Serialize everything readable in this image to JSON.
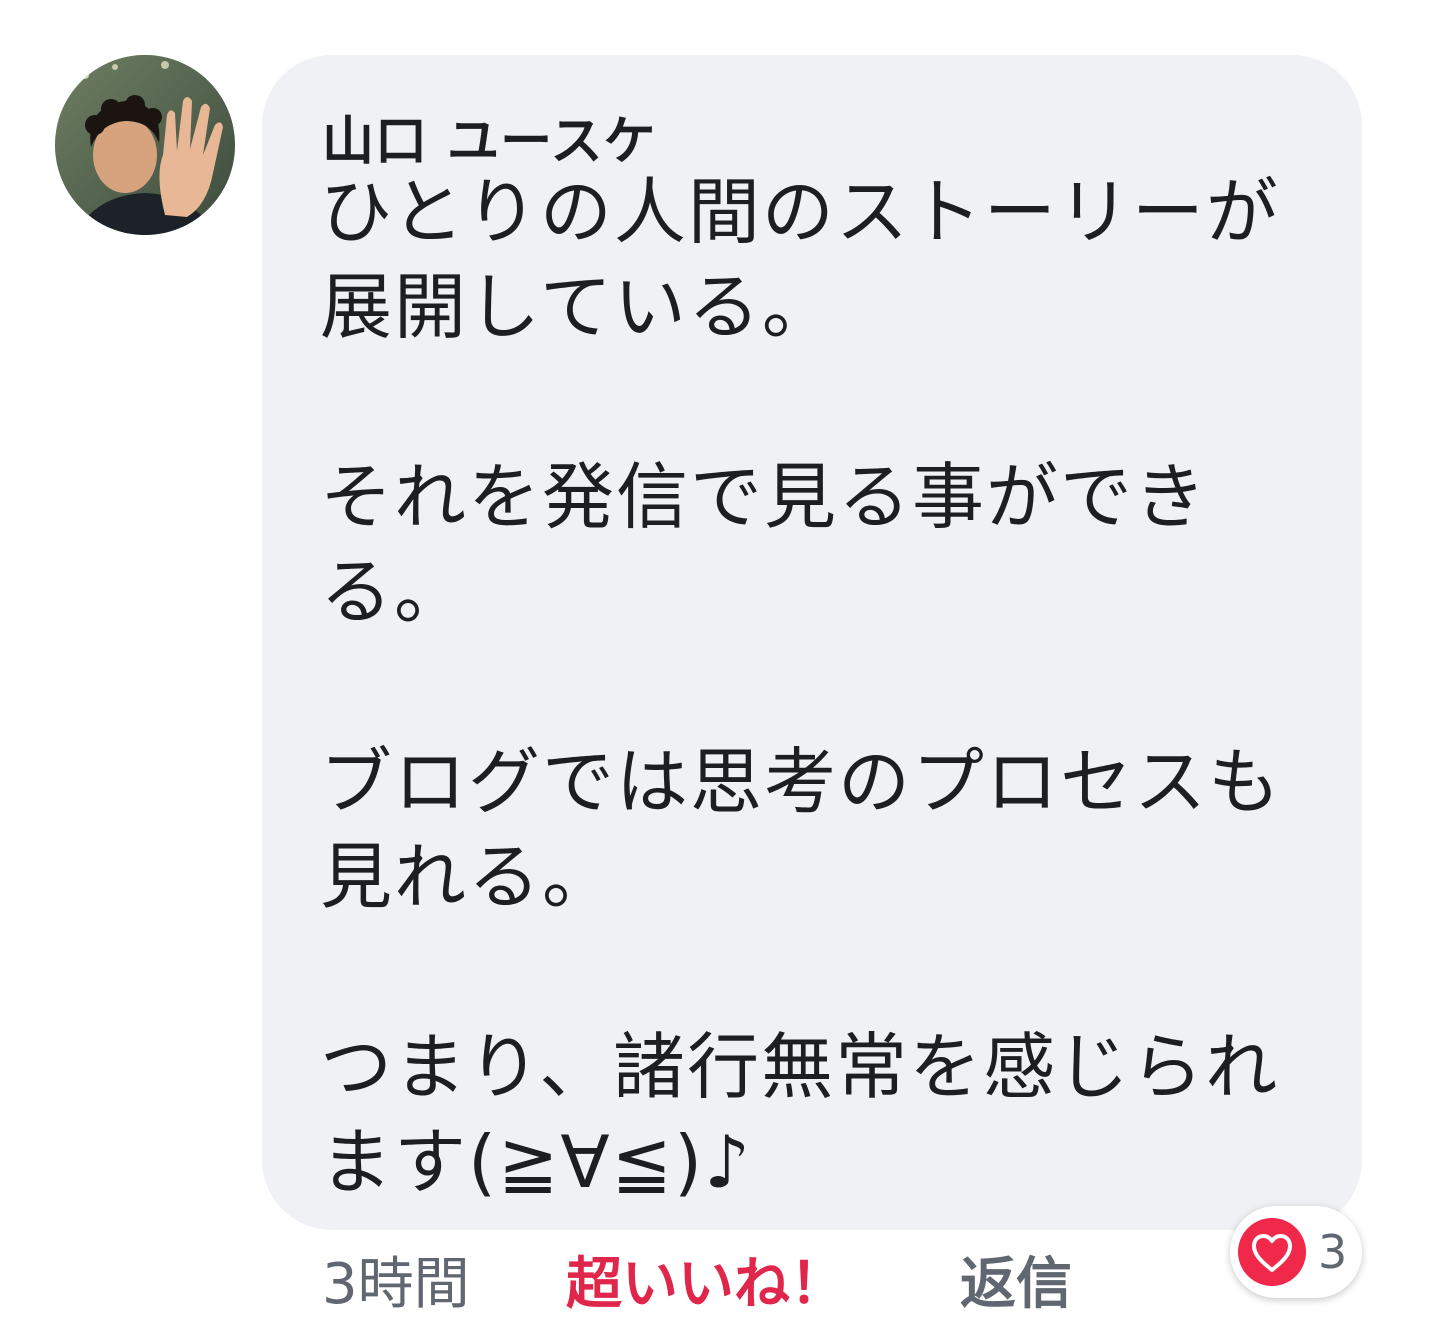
{
  "comment": {
    "author": "山口 ユースケ",
    "lines": [
      "ひとりの人間のストーリーが",
      "展開している。",
      "",
      "それを発信で見る事ができ",
      "る。",
      "",
      "ブログでは思考のプロセスも",
      "見れる。",
      "",
      "つまり、諸行無常を感じられ",
      "ます(≧∀≦)♪"
    ],
    "timestamp": "3時間",
    "like_label": "超いいね！",
    "reply_label": "返信",
    "reaction_count": "3",
    "reaction_icon": "heart-icon"
  },
  "colors": {
    "bubble_bg": "#f0f1f4",
    "like_color": "#e0264a",
    "heart_color": "#f0284a",
    "meta_text": "#606770"
  }
}
